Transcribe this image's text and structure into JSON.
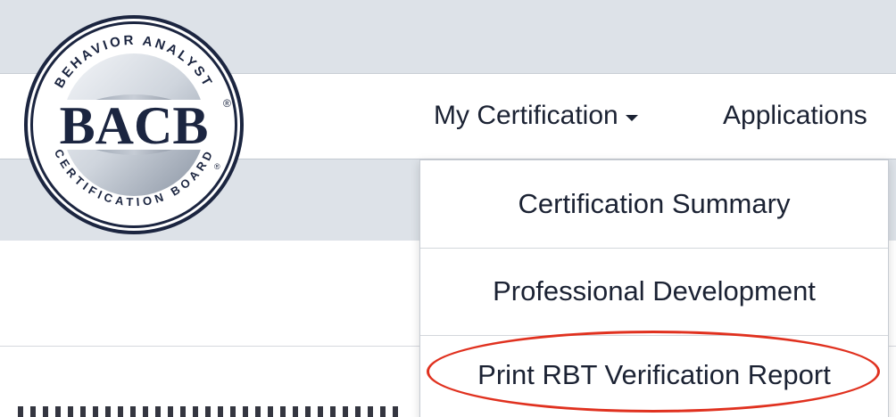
{
  "logo": {
    "arc_top": "BEHAVIOR ANALYST",
    "wordmark": "BACB",
    "registered": "®",
    "arc_bottom": "CERTIFICATION BOARD",
    "arc_bottom_mark": "®"
  },
  "nav": {
    "my_certification": "My Certification",
    "applications": "Applications"
  },
  "dropdown": {
    "items": [
      {
        "label": "Certification Summary"
      },
      {
        "label": "Professional Development"
      },
      {
        "label": "Print RBT Verification Report"
      }
    ],
    "highlighted_index": 2
  },
  "colors": {
    "brand_navy": "#1b2540",
    "highlight_ring": "#e0311f",
    "strip_gray": "#dde2e8"
  }
}
